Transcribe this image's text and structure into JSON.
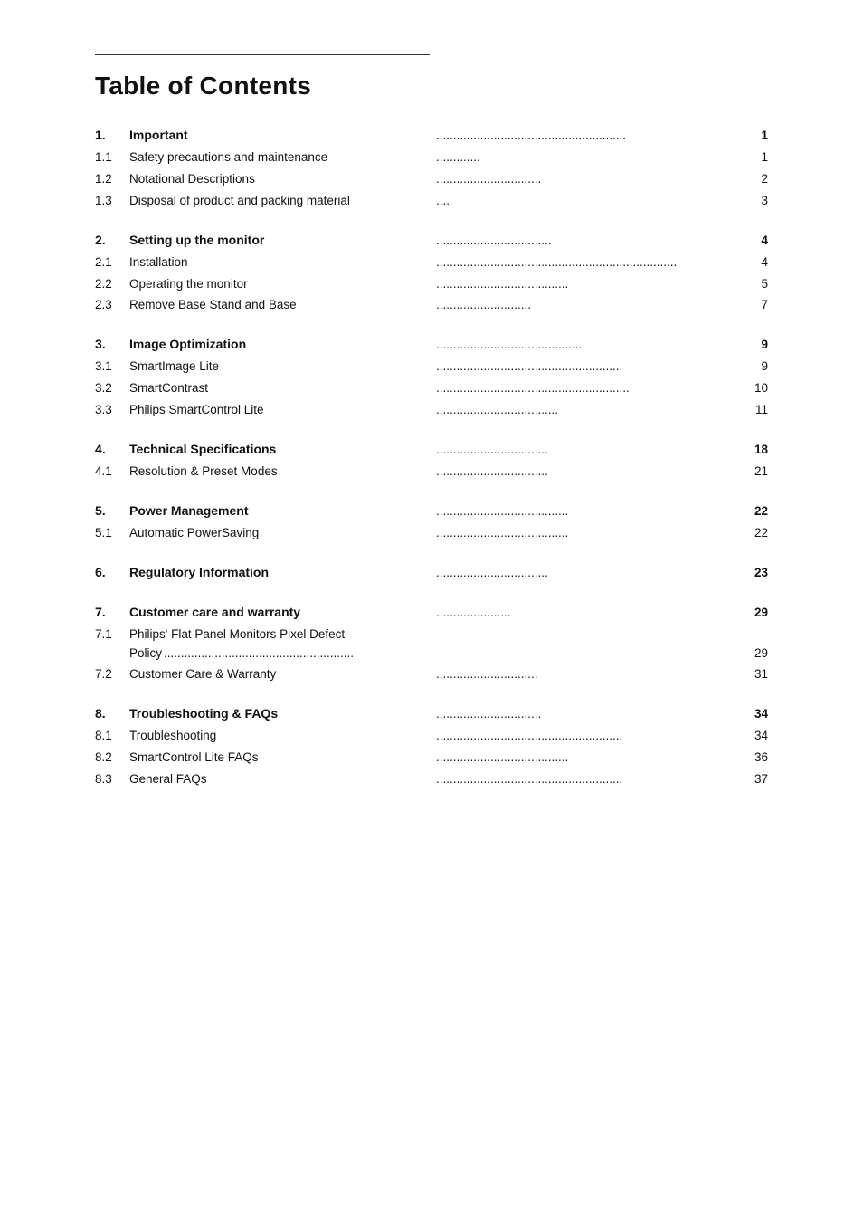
{
  "title": "Table of Contents",
  "sections": [
    {
      "chapter": "1.",
      "label": "Important",
      "dots": "........................................................",
      "page": "1",
      "isChapter": true,
      "subsections": [
        {
          "num": "1.1",
          "label": "Safety precautions and maintenance",
          "dots": ".............",
          "page": "1"
        },
        {
          "num": "1.2",
          "label": "Notational Descriptions",
          "dots": "...............................",
          "page": "2"
        },
        {
          "num": "1.3",
          "label": "Disposal of product and packing material",
          "dots": "....",
          "page": "3"
        }
      ]
    },
    {
      "chapter": "2.",
      "label": "Setting up the monitor",
      "dots": "..................................",
      "page": "4",
      "isChapter": true,
      "subsections": [
        {
          "num": "2.1",
          "label": "Installation",
          "dots": ".......................................................................",
          "page": "4"
        },
        {
          "num": "2.2",
          "label": "Operating the monitor",
          "dots": ".......................................",
          "page": "5"
        },
        {
          "num": "2.3",
          "label": "Remove Base Stand and Base",
          "dots": "............................",
          "page": "7"
        }
      ]
    },
    {
      "chapter": "3.",
      "label": "Image Optimization",
      "dots": "...........................................",
      "page": "9",
      "isChapter": true,
      "subsections": [
        {
          "num": "3.1",
          "label": "SmartImage Lite",
          "dots": ".......................................................",
          "page": "9"
        },
        {
          "num": "3.2",
          "label": "SmartContrast",
          "dots": ".........................................................",
          "page": "10"
        },
        {
          "num": "3.3",
          "label": "Philips SmartControl Lite",
          "dots": "....................................",
          "page": "11"
        }
      ]
    },
    {
      "chapter": "4.",
      "label": "Technical Specifications",
      "dots": ".................................",
      "page": "18",
      "isChapter": true,
      "subsections": [
        {
          "num": "4.1",
          "label": "Resolution & Preset Modes",
          "dots": ".................................",
          "page": "21"
        }
      ]
    },
    {
      "chapter": "5.",
      "label": "Power Management",
      "dots": ".......................................",
      "page": "22",
      "isChapter": true,
      "subsections": [
        {
          "num": "5.1",
          "label": "Automatic PowerSaving",
          "dots": ".......................................",
          "page": "22"
        }
      ]
    },
    {
      "chapter": "6.",
      "label": "Regulatory Information",
      "dots": ".................................",
      "page": "23",
      "isChapter": true,
      "subsections": []
    },
    {
      "chapter": "7.",
      "label": "Customer care and warranty",
      "dots": "......................",
      "page": "29",
      "isChapter": true,
      "subsections": [
        {
          "num": "7.1",
          "label": "Philips' Flat Panel Monitors Pixel Defect Policy",
          "dots": "........................................................",
          "page": "29",
          "multiline": true
        },
        {
          "num": "7.2",
          "label": "Customer Care & Warranty",
          "dots": "..............................",
          "page": "31"
        }
      ]
    },
    {
      "chapter": "8.",
      "label": "Troubleshooting & FAQs",
      "dots": "...............................",
      "page": "34",
      "isChapter": true,
      "subsections": [
        {
          "num": "8.1",
          "label": "Troubleshooting",
          "dots": ".......................................................",
          "page": "34"
        },
        {
          "num": "8.2",
          "label": "SmartControl Lite FAQs",
          "dots": ".......................................",
          "page": "36"
        },
        {
          "num": "8.3",
          "label": "General FAQs",
          "dots": ".......................................................",
          "page": "37"
        }
      ]
    }
  ]
}
